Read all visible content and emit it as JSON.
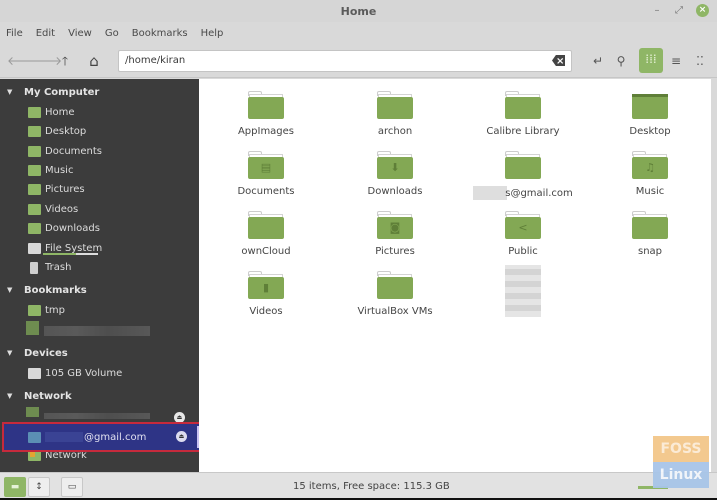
{
  "window": {
    "title": "Home",
    "controls": {
      "minimize": "–",
      "maximize": "⤢",
      "close": "×"
    }
  },
  "menubar": {
    "items": [
      "File",
      "Edit",
      "View",
      "Go",
      "Bookmarks",
      "Help"
    ]
  },
  "toolbar": {
    "back_icon": "🡐",
    "forward_icon": "🡒",
    "up_icon": "🡑",
    "home_icon": "⌂",
    "path": "/home/kiran",
    "toggle_location_icon": "↵",
    "search_icon": "⚲",
    "icon_view_icon": "⁞⁞⁞",
    "list_view_icon": "≡",
    "compact_view_icon": "⁚⁚"
  },
  "sidebar": {
    "sections": [
      {
        "title": "My Computer",
        "items": [
          "Home",
          "Desktop",
          "Documents",
          "Music",
          "Pictures",
          "Videos",
          "Downloads",
          "File System",
          "Trash"
        ]
      },
      {
        "title": "Bookmarks",
        "items": [
          "tmp"
        ]
      },
      {
        "title": "Devices",
        "items": [
          "105 GB Volume"
        ]
      },
      {
        "title": "Network",
        "items": [
          "@gmail.com",
          "Network"
        ]
      }
    ],
    "eject_icon": "⏏",
    "selected_item": "@gmail.com"
  },
  "files": [
    {
      "name": "AppImages",
      "glyph": ""
    },
    {
      "name": "archon",
      "glyph": ""
    },
    {
      "name": "Calibre Library",
      "glyph": ""
    },
    {
      "name": "Desktop",
      "glyph": ""
    },
    {
      "name": "Documents",
      "glyph": "▤"
    },
    {
      "name": "Downloads",
      "glyph": "⬇"
    },
    {
      "name": "s@gmail.com",
      "glyph": ""
    },
    {
      "name": "Music",
      "glyph": "♫"
    },
    {
      "name": "ownCloud",
      "glyph": ""
    },
    {
      "name": "Pictures",
      "glyph": "◙"
    },
    {
      "name": "Public",
      "glyph": "<"
    },
    {
      "name": "snap",
      "glyph": ""
    },
    {
      "name": "Videos",
      "glyph": "▮"
    },
    {
      "name": "VirtualBox VMs",
      "glyph": ""
    }
  ],
  "statusbar": {
    "text": "15 items, Free space: 115.3 GB",
    "places_icon": "▬",
    "tree_icon": "↕",
    "hide_sidebar_icon": "▭",
    "zoom_level": 0.5
  },
  "watermark": {
    "line1": "FOSS",
    "line2": "Linux"
  }
}
